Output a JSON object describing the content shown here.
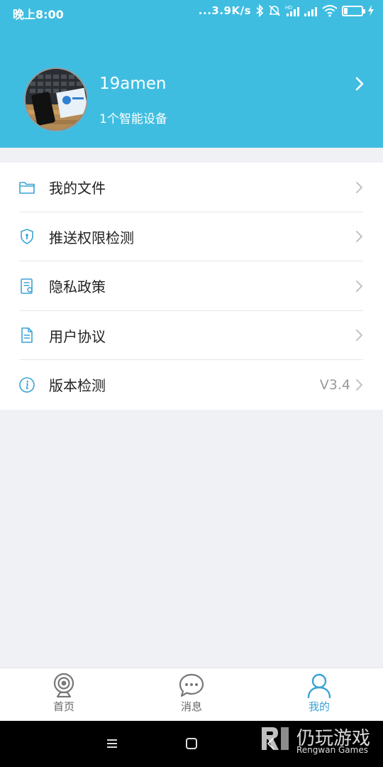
{
  "status_bar": {
    "time": "晚上8:00",
    "network_speed": "...3.9K/s",
    "battery_level": "19"
  },
  "profile": {
    "username": "19amen",
    "device_count": "1个智能设备"
  },
  "menu": {
    "items": [
      {
        "label": "我的文件",
        "icon": "folder-icon",
        "value": ""
      },
      {
        "label": "推送权限检测",
        "icon": "shield-icon",
        "value": ""
      },
      {
        "label": "隐私政策",
        "icon": "certificate-icon",
        "value": ""
      },
      {
        "label": "用户协议",
        "icon": "document-icon",
        "value": ""
      },
      {
        "label": "版本检测",
        "icon": "info-icon",
        "value": "V3.4"
      }
    ]
  },
  "tabbar": {
    "tabs": [
      {
        "label": "首页",
        "icon": "camera-icon",
        "active": false
      },
      {
        "label": "消息",
        "icon": "chat-bubble-icon",
        "active": false
      },
      {
        "label": "我的",
        "icon": "person-icon",
        "active": true
      }
    ]
  },
  "watermark": {
    "title": "仍玩游戏",
    "subtitle": "Rengwan Games"
  },
  "colors": {
    "header_bg": "#3fbde1",
    "accent": "#3aa3d6",
    "page_bg": "#f0f1f5"
  }
}
